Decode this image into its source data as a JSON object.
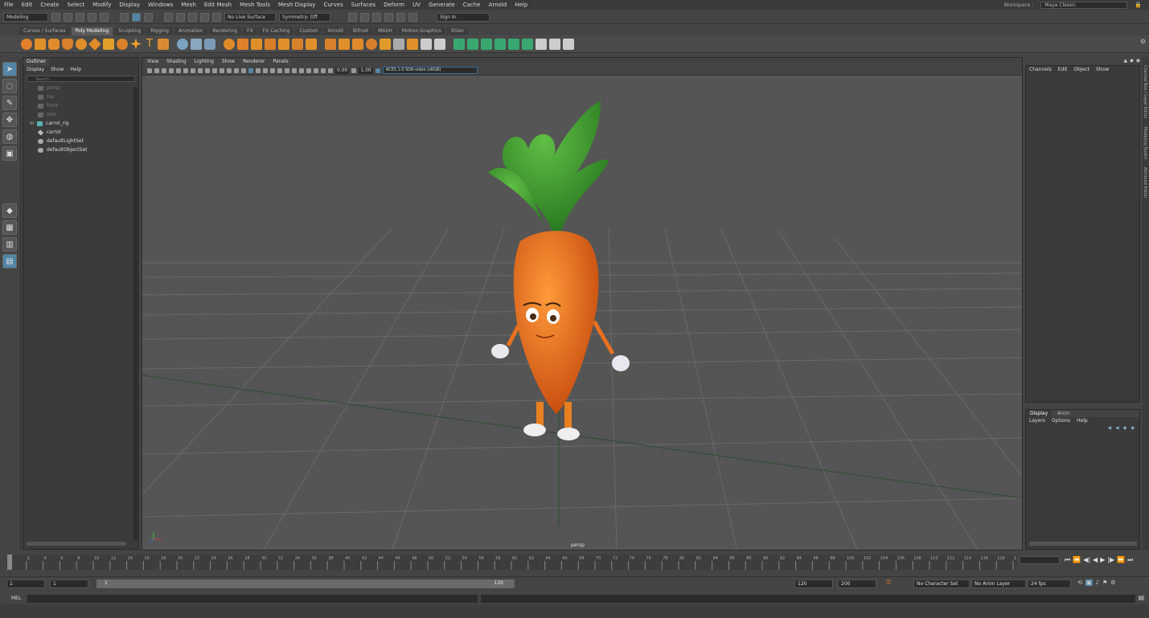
{
  "menus": [
    "File",
    "Edit",
    "Create",
    "Select",
    "Modify",
    "Display",
    "Windows",
    "Mesh",
    "Edit Mesh",
    "Mesh Tools",
    "Mesh Display",
    "Curves",
    "Surfaces",
    "Deform",
    "UV",
    "Generate",
    "Cache",
    "Arnold",
    "Help"
  ],
  "workspace": {
    "label": "Workspace :",
    "value": "Maya Classic"
  },
  "status": {
    "mode": "Modeling",
    "live_surface": "No Live Surface",
    "symmetry": "Symmetry: Off",
    "sign_in": "Sign In"
  },
  "shelf_tabs": [
    "Curves / Surfaces",
    "Poly Modeling",
    "Sculpting",
    "Rigging",
    "Animation",
    "Rendering",
    "FX",
    "FX Caching",
    "Custom",
    "Arnold",
    "Bifrost",
    "MASH",
    "Motion Graphics",
    "XGen"
  ],
  "active_shelf": "Poly Modeling",
  "outliner": {
    "title": "Outliner",
    "menu": [
      "Display",
      "Show",
      "Help"
    ],
    "search": "Search...",
    "items": [
      {
        "label": "persp",
        "dim": true
      },
      {
        "label": "top",
        "dim": true
      },
      {
        "label": "front",
        "dim": true
      },
      {
        "label": "side",
        "dim": true
      },
      {
        "label": "carrot_rig",
        "dim": false
      },
      {
        "label": "carrot",
        "dim": false
      },
      {
        "label": "defaultLightSet",
        "dim": false
      },
      {
        "label": "defaultObjectSet",
        "dim": false
      }
    ]
  },
  "viewport": {
    "menu": [
      "View",
      "Shading",
      "Lighting",
      "Show",
      "Renderer",
      "Panels"
    ],
    "near": "0.00",
    "far": "1.00",
    "colorspace": "ACES 1.0 SDR-video (sRGB)",
    "camera": "persp"
  },
  "channelbox": {
    "menu": [
      "Channels",
      "Edit",
      "Object",
      "Show"
    ]
  },
  "layer_editor": {
    "tabs": [
      "Display",
      "Anim"
    ],
    "menu": [
      "Layers",
      "Options",
      "Help"
    ]
  },
  "side_tabs": [
    "Channel Box / Layer Editor",
    "Modeling Toolkit",
    "Attribute Editor"
  ],
  "timeline": {
    "ticks": [
      "1",
      "2",
      "4",
      "6",
      "8",
      "10",
      "12",
      "14",
      "16",
      "18",
      "20",
      "22",
      "24",
      "26",
      "28",
      "30",
      "32",
      "34",
      "36",
      "38",
      "40",
      "42",
      "44",
      "46",
      "48",
      "50",
      "52",
      "54",
      "56",
      "58",
      "60",
      "62",
      "64",
      "66",
      "68",
      "70",
      "72",
      "74",
      "76",
      "78",
      "80",
      "82",
      "84",
      "86",
      "88",
      "90",
      "92",
      "94",
      "96",
      "98",
      "100",
      "102",
      "104",
      "106",
      "108",
      "110",
      "112",
      "114",
      "116",
      "118",
      "120"
    ],
    "current": "1"
  },
  "range": {
    "start": "1",
    "anim_start": "1",
    "slider_start": "1",
    "slider_end": "120",
    "end": "120",
    "anim_end": "200",
    "char_set": "No Character Set",
    "anim_layer": "No Anim Layer",
    "fps": "24 fps"
  },
  "cmdline": {
    "lang": "MEL"
  },
  "colors": {
    "accent": "#5285a6",
    "carrot": "#e8701f",
    "leaves": "#3d8b2a",
    "grid": "#6a6a6a",
    "bg": "#555555"
  }
}
